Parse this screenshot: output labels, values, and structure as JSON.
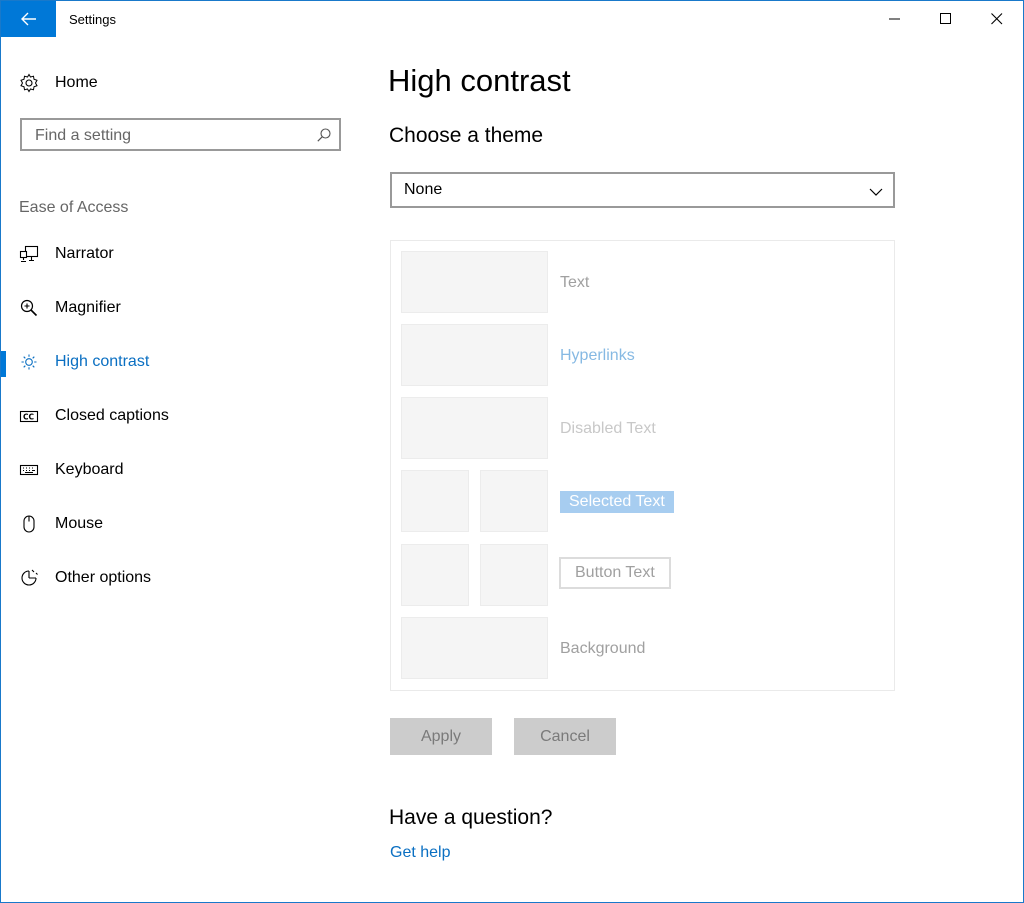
{
  "window": {
    "title": "Settings"
  },
  "sidebar": {
    "home_label": "Home",
    "search_placeholder": "Find a setting",
    "group_label": "Ease of Access",
    "items": [
      {
        "label": "Narrator",
        "icon": "narrator-icon"
      },
      {
        "label": "Magnifier",
        "icon": "magnifier-icon"
      },
      {
        "label": "High contrast",
        "icon": "brightness-icon",
        "active": true
      },
      {
        "label": "Closed captions",
        "icon": "closed-captions-icon"
      },
      {
        "label": "Keyboard",
        "icon": "keyboard-icon"
      },
      {
        "label": "Mouse",
        "icon": "mouse-icon"
      },
      {
        "label": "Other options",
        "icon": "other-options-icon"
      }
    ]
  },
  "main": {
    "title": "High contrast",
    "theme_heading": "Choose a theme",
    "theme_selected": "None",
    "preview": {
      "text": "Text",
      "hyperlinks": "Hyperlinks",
      "disabled_text": "Disabled Text",
      "selected_text": "Selected Text",
      "button_text": "Button Text",
      "background": "Background"
    },
    "apply_label": "Apply",
    "cancel_label": "Cancel",
    "question_heading": "Have a question?",
    "help_link": "Get help"
  },
  "colors": {
    "accent": "#0078d7",
    "link": "#0a6fc2",
    "selected_bg": "#a7cdf0",
    "button_bg": "#cccccc"
  }
}
